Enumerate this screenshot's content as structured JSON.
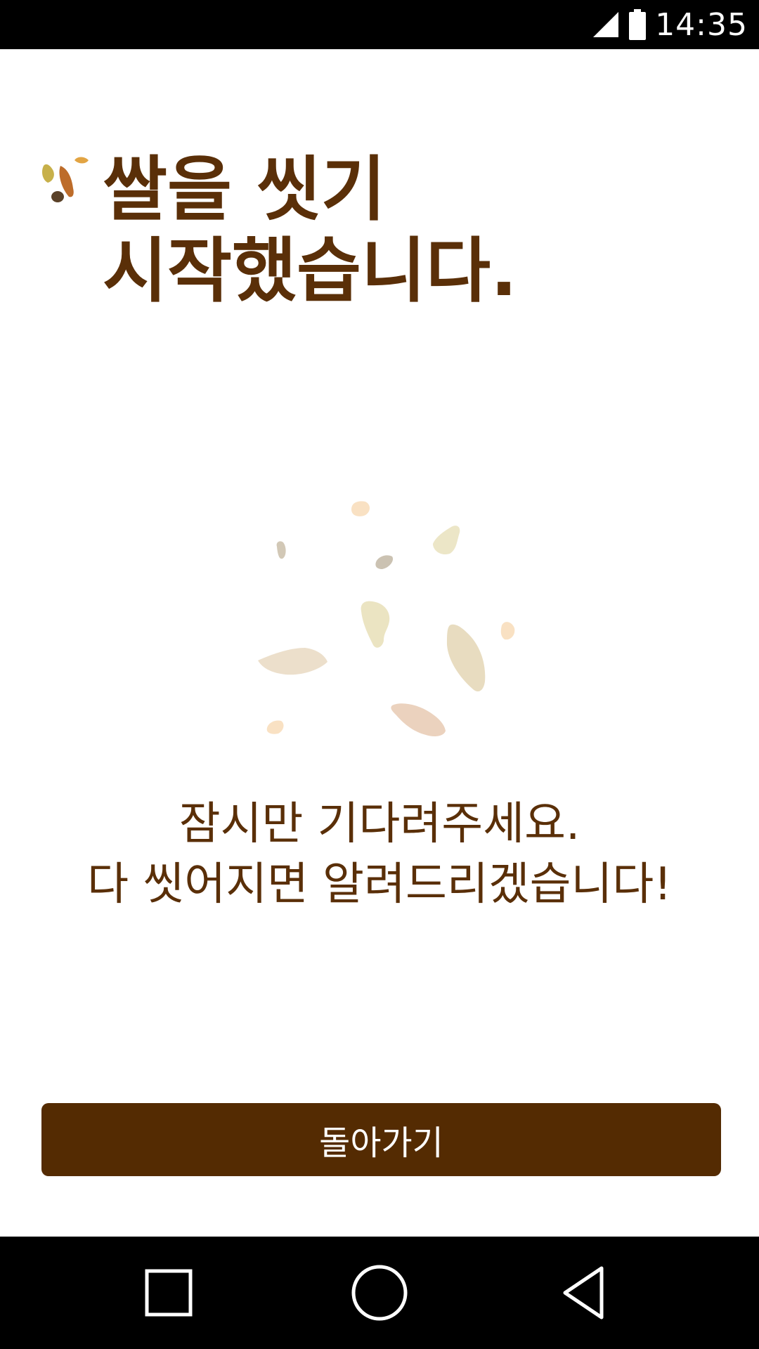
{
  "status_bar": {
    "time": "14:35",
    "icons": [
      "signal-icon",
      "battery-icon"
    ]
  },
  "header": {
    "logo_icon": "rice-grains-logo-icon",
    "title_line1": "쌀을 씻기",
    "title_line2": "시작했습니다."
  },
  "illustration": {
    "icon": "rice-grains-illustration"
  },
  "message": {
    "line1": "잠시만 기다려주세요.",
    "line2": "다 씻어지면 알려드리겠습니다!"
  },
  "actions": {
    "back_label": "돌아가기"
  },
  "nav_bar": {
    "icons": [
      "recent-apps-icon",
      "home-icon",
      "back-icon"
    ]
  },
  "colors": {
    "primary_brown": "#542b02",
    "text_brown": "#5a2f08",
    "background": "#ffffff"
  }
}
